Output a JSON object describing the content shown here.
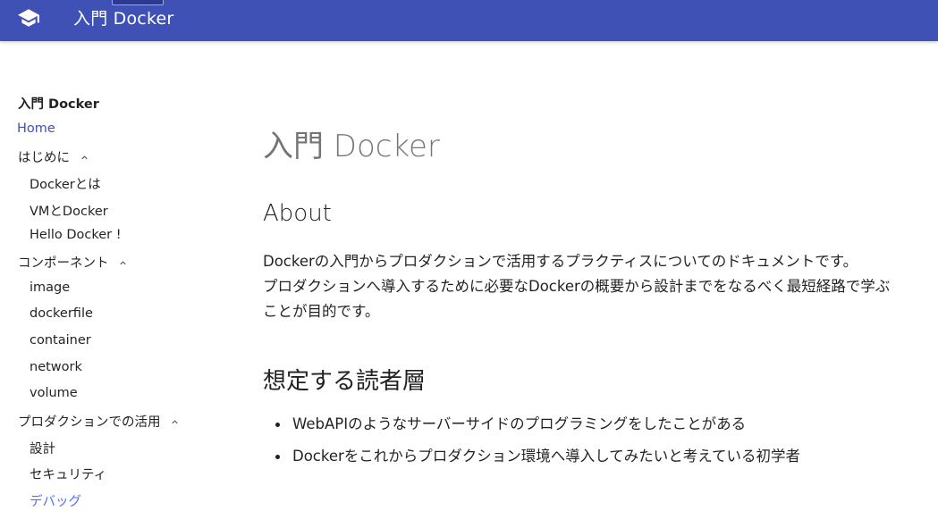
{
  "header": {
    "title": "入門 Docker",
    "logo_icon": "school-icon",
    "bg_color": "#3f51b5"
  },
  "sidebar": {
    "title": "入門 Docker",
    "items": [
      {
        "label": "Home",
        "level": 0,
        "state": "active"
      },
      {
        "label": "はじめに",
        "level": 0,
        "expanded": true
      },
      {
        "label": "Dockerとは",
        "level": 1
      },
      {
        "label": "VMとDocker",
        "level": 1
      },
      {
        "label": "Hello Docker !",
        "level": 1
      },
      {
        "label": "コンポーネント",
        "level": 0,
        "expanded": true
      },
      {
        "label": "image",
        "level": 1
      },
      {
        "label": "dockerfile",
        "level": 1
      },
      {
        "label": "container",
        "level": 1
      },
      {
        "label": "network",
        "level": 1
      },
      {
        "label": "volume",
        "level": 1
      },
      {
        "label": "プロダクションでの活用",
        "level": 0,
        "expanded": true
      },
      {
        "label": "設計",
        "level": 1
      },
      {
        "label": "セキュリティ",
        "level": 1
      },
      {
        "label": "デバッグ",
        "level": 1,
        "state": "highlight"
      }
    ]
  },
  "main": {
    "page_title": "入門 Docker",
    "about_heading": "About",
    "about_lines": [
      "Dockerの入門からプロダクションで活用するプラクティスについてのドキュメントです。",
      "プロダクションへ導入するために必要なDockerの概要から設計までをなるべく最短経路で学ぶ",
      "ことが目的です。"
    ],
    "audience_heading": "想定する読者層",
    "audience_items": [
      "WebAPIのようなサーバーサイドのプログラミングをしたことがある",
      "Dockerをこれからプロダクション環境へ導入してみたいと考えている初学者"
    ]
  },
  "colors": {
    "accent": "#3f51b5",
    "link_light": "#536dfe"
  }
}
